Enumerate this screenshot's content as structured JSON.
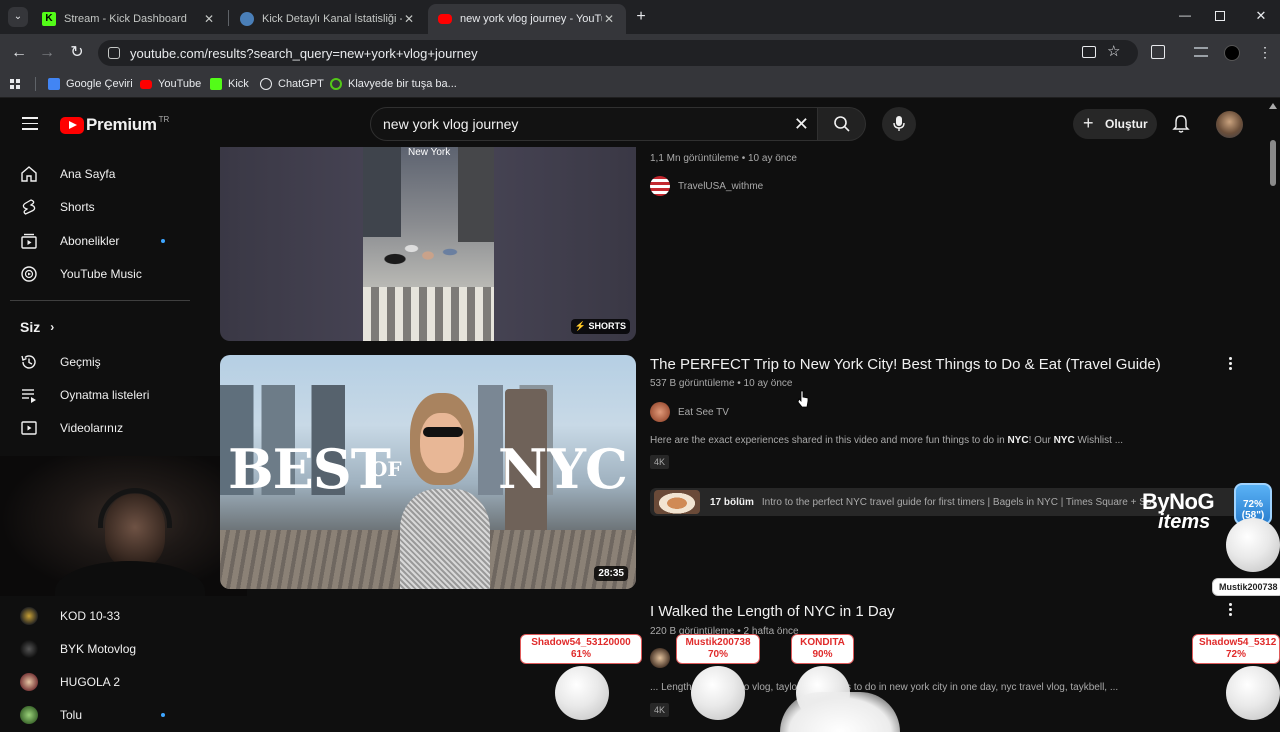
{
  "browser": {
    "tabs": [
      {
        "title": "Stream - Kick Dashboard"
      },
      {
        "title": "Kick Detaylı Kanal İstatisliği - M"
      },
      {
        "title": "new york vlog journey - YouTube"
      }
    ],
    "url": "youtube.com/results?search_query=new+york+vlog+journey",
    "bookmarks": [
      "Google Çeviri",
      "YouTube",
      "Kick",
      "ChatGPT",
      "Klavyede bir tuşa ba..."
    ]
  },
  "youtube": {
    "logo_text": "Premium",
    "region": "TR",
    "search_value": "new york vlog journey",
    "create_label": "Oluştur"
  },
  "sidebar": {
    "main": [
      "Ana Sayfa",
      "Shorts",
      "Abonelikler",
      "YouTube Music"
    ],
    "you_label": "Siz",
    "you_items": [
      "Geçmiş",
      "Oynatma listeleri",
      "Videolarınız"
    ],
    "subs": [
      "KOD 10-33",
      "BYK Motovlog",
      "HUGOLA 2",
      "Tolu"
    ]
  },
  "results": [
    {
      "thumb_caption": "New York",
      "shorts_label": "SHORTS",
      "meta": "1,1 Mn görüntüleme • 10 ay önce",
      "channel": "TravelUSA_withme"
    },
    {
      "title": "The PERFECT Trip to New York City! Best Things to Do & Eat (Travel Guide)",
      "meta": "537 B görüntüleme • 10 ay önce",
      "channel": "Eat See TV",
      "snippet_pre": "Here are the exact experiences shared in this video and more fun things to do in ",
      "snippet_b1": "NYC",
      "snippet_mid": "! Our ",
      "snippet_b2": "NYC",
      "snippet_post": " Wishlist ...",
      "badge": "4K",
      "duration": "28:35",
      "thumb_text_big": "BEST",
      "thumb_text_small": "OF",
      "thumb_text_city": "NYC",
      "chapters_count": "17 bölüm",
      "chapters_text": "Intro to the perfect NYC travel guide for first timers | Bagels in NYC | Times Square + So"
    },
    {
      "title": "I Walked the Length of NYC in 1 Day",
      "meta": "220 B görüntüleme • 2 hafta önce",
      "snippet": "... Length        Day, what to                    vlog, taylor bell, things to do in new york city in one day, nyc travel vlog, taykbell, ...",
      "badge": "4K"
    }
  ],
  "overlays": {
    "logo_line1": "ByNoG",
    "logo_line2": "items",
    "badge_pct": "72%",
    "badge_sub": "(58\")",
    "tags": [
      {
        "name": "Mustik200738",
        "pct": ""
      },
      {
        "name": "Shadow54_53120000",
        "pct": "61%"
      },
      {
        "name": "Mustik200738",
        "pct": "70%"
      },
      {
        "name": "KONDITA",
        "pct": "90%"
      },
      {
        "name": "Shadow54_5312",
        "pct": "72%"
      }
    ]
  },
  "colors": {
    "yt_red": "#ff0000",
    "bg": "#0f0f0f",
    "kick_green": "#53fc18",
    "tag_red": "#e02b2b"
  }
}
